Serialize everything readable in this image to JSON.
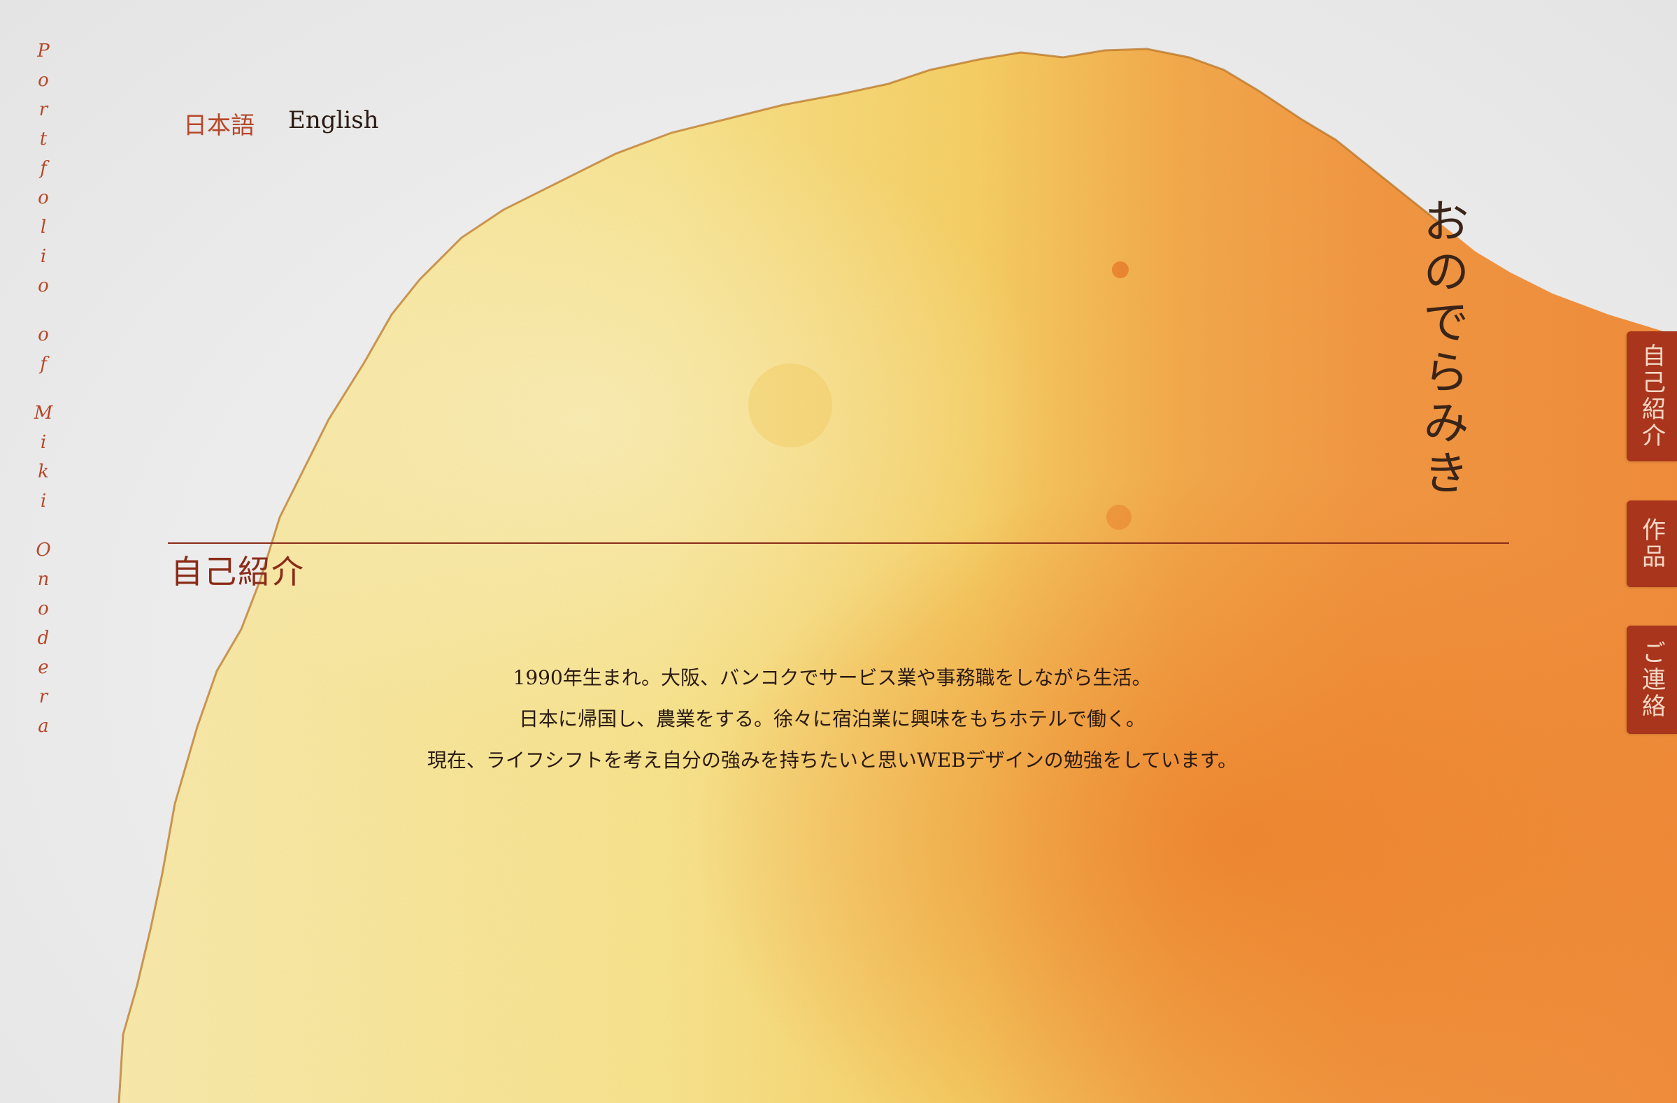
{
  "side_title": {
    "letters": [
      "P",
      "o",
      "r",
      "t",
      "f",
      "o",
      "l",
      "i",
      "o",
      "",
      "o",
      "f",
      "",
      "M",
      "i",
      "k",
      "i",
      "",
      "O",
      "n",
      "o",
      "d",
      "e",
      "r",
      "a"
    ]
  },
  "lang": {
    "japanese": "日本語",
    "english": "English"
  },
  "name": "おのでらみき",
  "nav": {
    "about": "自己紹介",
    "works": "作品",
    "contact": "ご連絡"
  },
  "section": {
    "title": "自己紹介",
    "lines": [
      "1990年生まれ。大阪、バンコクでサービス業や事務職をしながら生活。",
      "日本に帰国し、農業をする。徐々に宿泊業に興味をもちホテルで働く。",
      "現在、ライフシフトを考え自分の強みを持ちたいと思いWEBデザインの勉強をしています。"
    ]
  },
  "colors": {
    "accent": "#b5482a",
    "nav_bg": "#a8351c",
    "section": "#8a2c18",
    "watercolor_light": "#f7e59a",
    "watercolor_orange": "#f08a30"
  }
}
